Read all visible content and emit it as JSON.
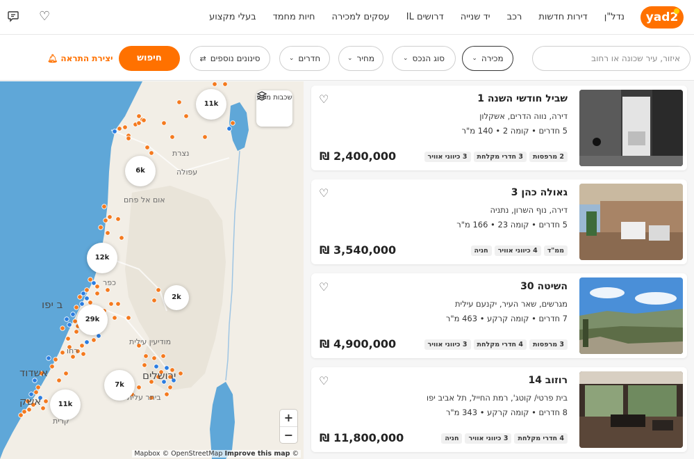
{
  "header": {
    "logo": "yad2",
    "nav": [
      "נדל\"ן",
      "דירות חדשות",
      "רכב",
      "יד שנייה",
      "דרושים IL",
      "עסקים למכירה",
      "חיות מחמד",
      "בעלי מקצוע"
    ],
    "icons": [
      "heart-icon",
      "chat-icon"
    ]
  },
  "filters": {
    "search_placeholder": "איזור, עיר שכונה או רחוב",
    "deal_type": "מכירה",
    "property_type": "סוג הנכס",
    "price": "מחיר",
    "rooms": "חדרים",
    "more_filters": "סינונים נוספים",
    "search_button": "חיפוש",
    "create_alert": "יצירת התראה"
  },
  "map": {
    "layers_button": "שכבות מידע",
    "labels": {
      "nazareth": "נצרת",
      "afula": "עפולה",
      "umm_al_fahm": "אום אל פחם",
      "kfar": "כפר",
      "jaffa": "ב יפו",
      "modiin": "מודיעין עילית",
      "rehovot": "רחו",
      "ashdod": "אשדוד",
      "jerusalem": "ירושלים",
      "beitar": "ביתר עלית",
      "ashkelon": "אשק",
      "kiryat": "קרית"
    },
    "clusters": [
      "11k",
      "6k",
      "12k",
      "2k",
      "29k",
      "7k",
      "11k"
    ],
    "zoom_in": "+",
    "zoom_out": "−",
    "attribution_mapbox": "Mapbox ©",
    "attribution_osm": "OpenStreetMap",
    "attribution_improve": "Improve this map",
    "attribution_end": "©"
  },
  "listings": [
    {
      "title": "שביל חודשי השנה 1",
      "subtitle": "דירה, נווה הדרים, אשקלון",
      "details": "5 חדרים • קומה 2 • 140 מ\"ר",
      "tags": [
        "2 מרפסות",
        "3 חדרי מקלחת",
        "3 כיווני אוויר"
      ],
      "price": "₪ 2,400,000"
    },
    {
      "title": "גאולה כהן 3",
      "subtitle": "דירה, נוף השרון, נתניה",
      "details": "5 חדרים • קומה 23 • 166 מ\"ר",
      "tags": [
        "ממ\"ד",
        "4 כיווני אוויר",
        "חניה"
      ],
      "price": "₪ 3,540,000"
    },
    {
      "title": "השיטה 30",
      "subtitle": "מגרשים, שאר העיר, יקנעם עילית",
      "details": "7 חדרים • קומה קרקע • 463 מ\"ר",
      "tags": [
        "3 מרפסות",
        "4 חדרי מקלחת",
        "3 כיווני אוויר"
      ],
      "price": "₪ 4,900,000"
    },
    {
      "title": "רוזוב 14",
      "subtitle": "בית פרטי/ קוטג', רמת החייל, תל אביב יפו",
      "details": "8 חדרים • קומה קרקע • 343 מ\"ר",
      "tags": [
        "4 חדרי מקלחת",
        "3 כיווני אוויר",
        "חניה"
      ],
      "price": "₪ 11,800,000"
    }
  ],
  "colors": {
    "brand": "#ff7100",
    "brand_yellow": "#ffcc00",
    "sea": "#5fa7d8",
    "land": "#f2eee6",
    "marker_orange": "#f47a1f",
    "marker_blue": "#2b7de1"
  }
}
